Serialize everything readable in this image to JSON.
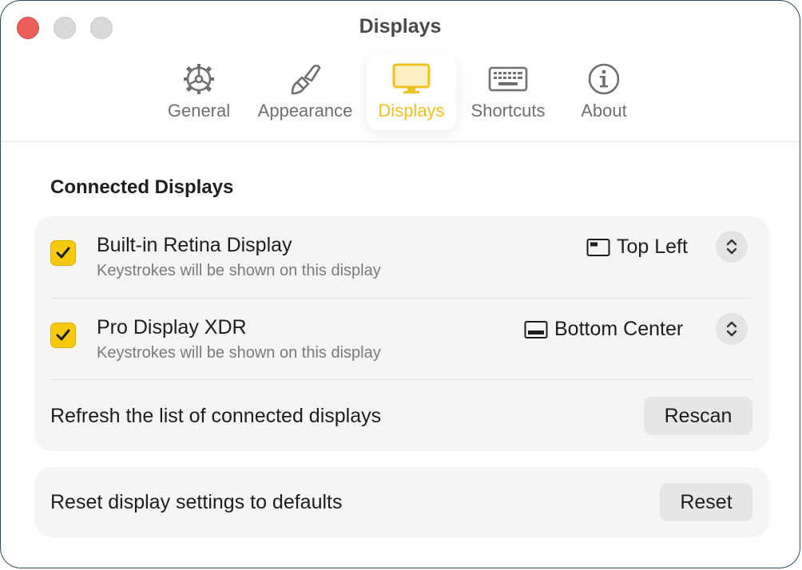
{
  "window": {
    "title": "Displays",
    "controls": [
      "close",
      "minimize",
      "maximize"
    ]
  },
  "toolbar": {
    "tabs": [
      {
        "label": "General",
        "icon": "gear-icon",
        "active": false
      },
      {
        "label": "Appearance",
        "icon": "paintbrush-icon",
        "active": false
      },
      {
        "label": "Displays",
        "icon": "display-icon",
        "active": true
      },
      {
        "label": "Shortcuts",
        "icon": "keyboard-icon",
        "active": false
      },
      {
        "label": "About",
        "icon": "info-icon",
        "active": false
      }
    ],
    "accent": "#f0c020"
  },
  "connected": {
    "heading": "Connected Displays",
    "displays": [
      {
        "name": "Built-in Retina Display",
        "subtitle": "Keystrokes will be shown on this display",
        "checked": true,
        "position": "Top Left",
        "position_icon": "position-top-left-icon"
      },
      {
        "name": "Pro Display XDR",
        "subtitle": "Keystrokes will be shown on this display",
        "checked": true,
        "position": "Bottom Center",
        "position_icon": "position-bottom-center-icon"
      }
    ],
    "refresh": {
      "label": "Refresh the list of connected displays",
      "button": "Rescan"
    }
  },
  "reset": {
    "label": "Reset display settings to defaults",
    "button": "Reset"
  },
  "colors": {
    "checkbox": "#f7c90f",
    "close_light": "#ee5e58"
  }
}
